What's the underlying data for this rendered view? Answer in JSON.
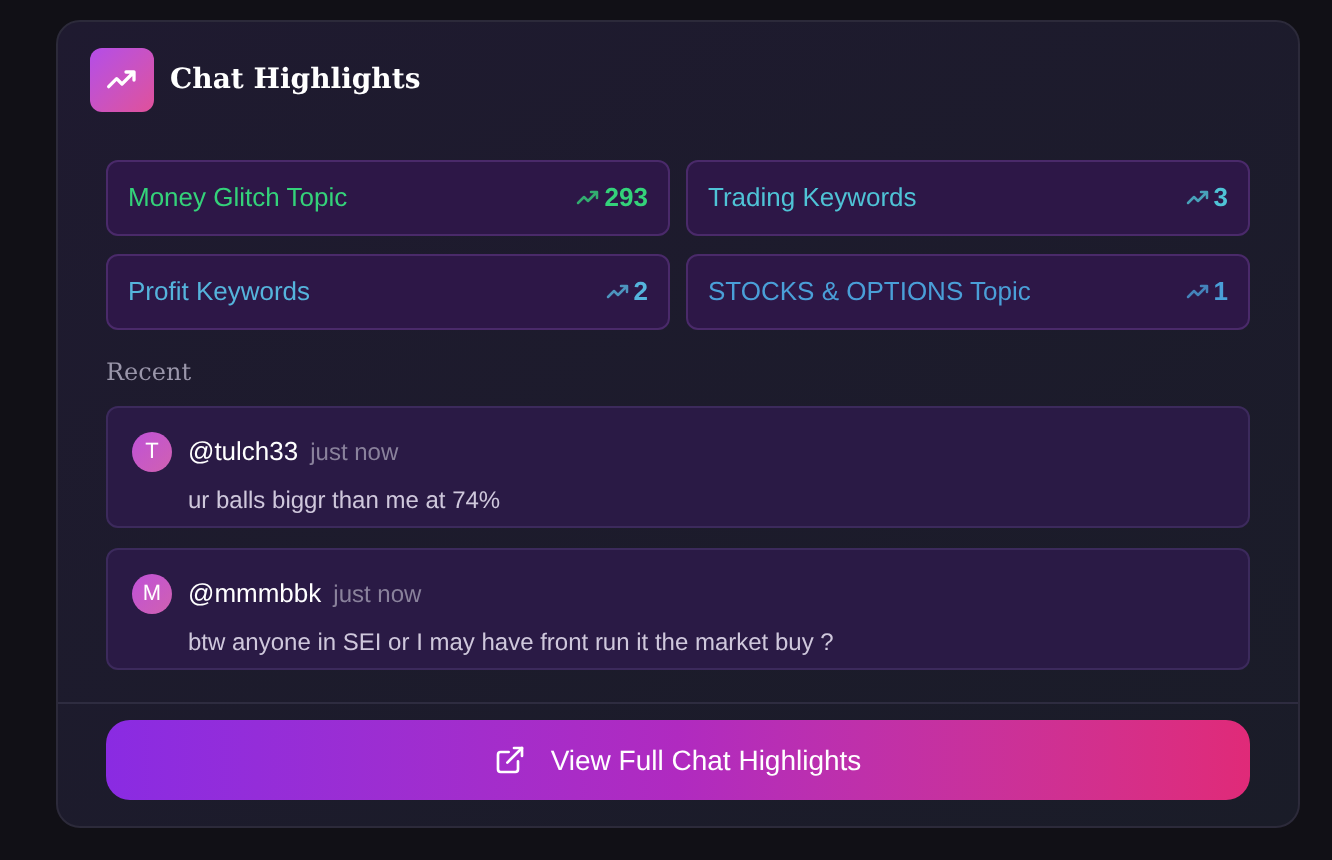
{
  "title": "Chat Highlights",
  "topics": [
    {
      "label": "Money Glitch Topic",
      "count": "293",
      "color": "#34d27a"
    },
    {
      "label": "Trading Keywords",
      "count": "3",
      "color": "#4fc3d6"
    },
    {
      "label": "Profit Keywords",
      "count": "2",
      "color": "#55b4dc"
    },
    {
      "label": "STOCKS & OPTIONS Topic",
      "count": "1",
      "color": "#4a9fd8"
    }
  ],
  "recent_heading": "Recent",
  "messages": [
    {
      "initial": "T",
      "user": "@tulch33",
      "time": "just now",
      "text": "ur balls biggr than me at 74%"
    },
    {
      "initial": "M",
      "user": "@mmmbbk",
      "time": "just now",
      "text": "btw anyone in SEI or I may have front run it the market buy ?"
    }
  ],
  "button": "View Full Chat Highlights"
}
